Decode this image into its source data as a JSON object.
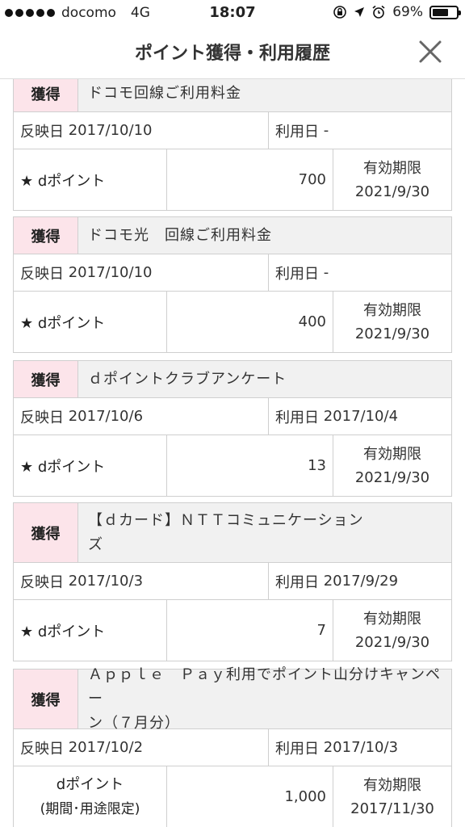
{
  "status_bar": {
    "carrier": "docomo",
    "network": "4G",
    "time": "18:07",
    "battery": "69%",
    "battery_level": 0.69
  },
  "header": {
    "title": "ポイント獲得・利用履歴",
    "close_icon": "close-icon"
  },
  "labels": {
    "reflect_date": "反映日",
    "use_date": "利用日",
    "expiry": "有効期限"
  },
  "items": [
    {
      "badge": "獲得",
      "description": "ドコモ回線ご利用料金",
      "reflect_date": "2017/10/10",
      "use_date": "-",
      "point_label": "★ dポイント",
      "points": "700",
      "expiry": "2021/9/30"
    },
    {
      "badge": "獲得",
      "description": "ドコモ光　回線ご利用料金",
      "reflect_date": "2017/10/10",
      "use_date": "-",
      "point_label": "★ dポイント",
      "points": "400",
      "expiry": "2021/9/30"
    },
    {
      "badge": "獲得",
      "description": "ｄポイントクラブアンケート",
      "reflect_date": "2017/10/6",
      "use_date": "2017/10/4",
      "point_label": "★ dポイント",
      "points": "13",
      "expiry": "2021/9/30"
    },
    {
      "badge": "獲得",
      "description_line1": "【ｄカード】ＮＴＴコミュニケーション",
      "description_line2": "ズ",
      "reflect_date": "2017/10/3",
      "use_date": "2017/9/29",
      "point_label": "★ dポイント",
      "points": "7",
      "expiry": "2021/9/30"
    },
    {
      "badge": "獲得",
      "description_line1": "Ａｐｐｌｅ　Ｐａｙ利用でポイント山分けキャンペー",
      "description_line2": "ン（７月分）",
      "reflect_date": "2017/10/2",
      "use_date": "2017/10/3",
      "point_label_line1": "dポイント",
      "point_label_line2": "(期間･用途限定)",
      "points": "1,000",
      "expiry": "2017/11/30"
    }
  ]
}
